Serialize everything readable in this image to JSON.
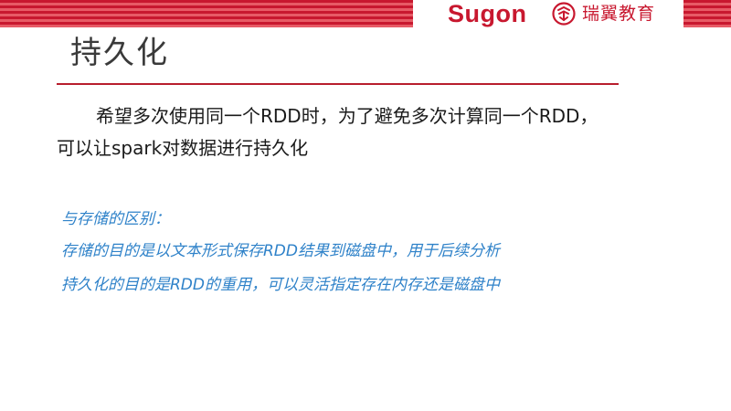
{
  "header": {
    "brand_sugon": "Sugon",
    "brand_ruiyi": "瑞翼教育",
    "colors": {
      "brand_red": "#c8182f",
      "stripe_dark": "#c8182f",
      "stripe_light": "#e75b66"
    },
    "icons": {
      "ruiyi_logo": "ruiyi-logo-icon"
    }
  },
  "slide": {
    "title": "持久化",
    "paragraph_line1": "希望多次使用同一个RDD时，为了避免多次计算同一个RDD，",
    "paragraph_line2": "可以让spark对数据进行持久化"
  },
  "note": {
    "heading": "与存储的区别：",
    "line1": "存储的目的是以文本形式保存RDD结果到磁盘中，用于后续分析",
    "line2": "持久化的目的是RDD的重用，可以灵活指定存在内存还是磁盘中",
    "color": "#2f82c9"
  }
}
